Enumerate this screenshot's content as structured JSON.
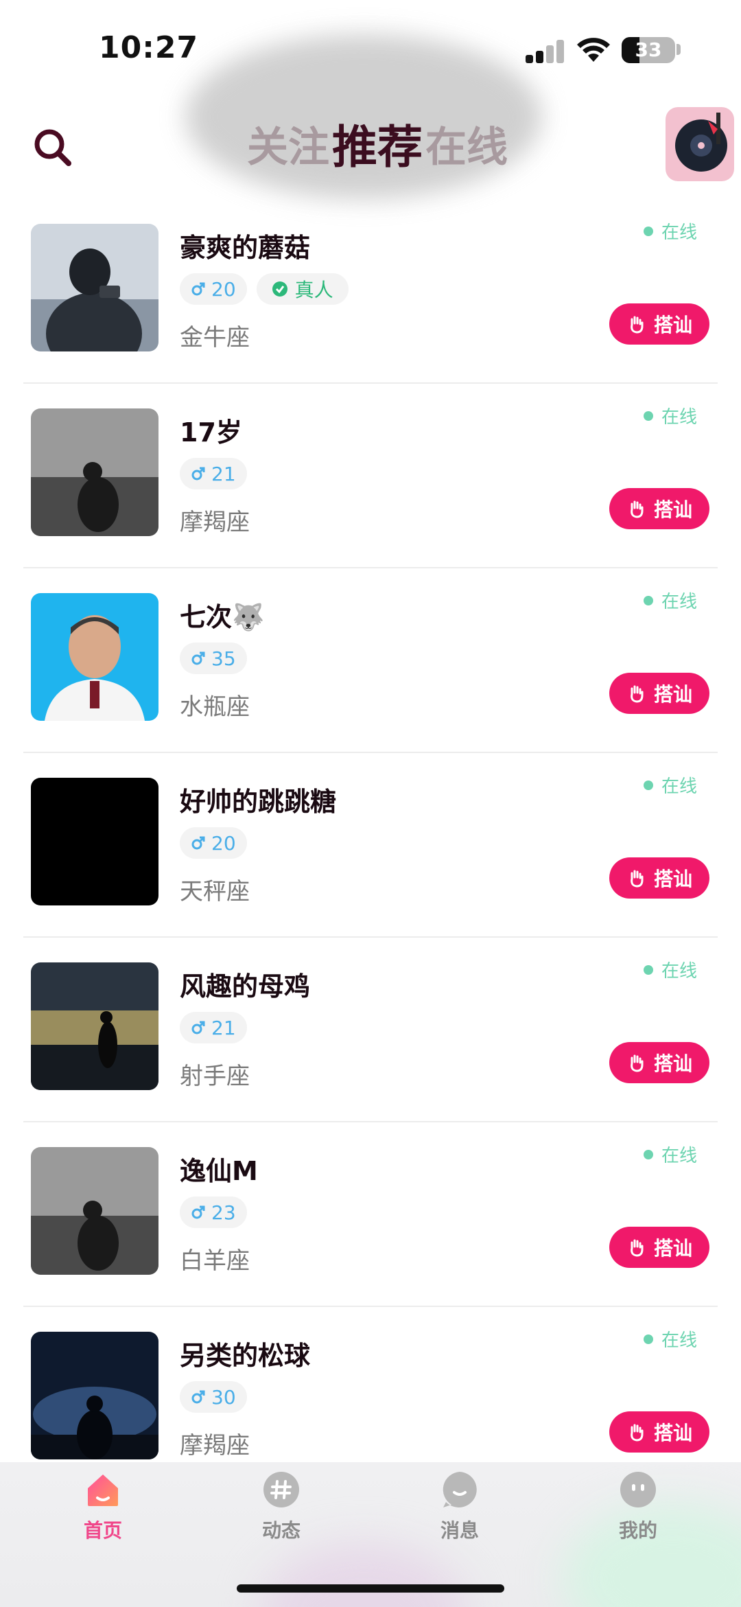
{
  "status": {
    "time": "10:27",
    "battery": "33"
  },
  "header": {
    "tabs": [
      {
        "label": "关注",
        "active": false
      },
      {
        "label": "推荐",
        "active": true
      },
      {
        "label": "在线",
        "active": false
      }
    ],
    "accent_gradient": [
      "#ef3d8a",
      "#ff8a3d"
    ]
  },
  "users": [
    {
      "name": "豪爽的蘑菇",
      "age": "20",
      "verified_label": "真人",
      "zodiac": "金牛座",
      "status": "在线",
      "action": "搭讪"
    },
    {
      "name": "17岁",
      "age": "21",
      "zodiac": "摩羯座",
      "status": "在线",
      "action": "搭讪"
    },
    {
      "name": "七次🐺",
      "age": "35",
      "zodiac": "水瓶座",
      "status": "在线",
      "action": "搭讪"
    },
    {
      "name": "好帅的跳跳糖",
      "age": "20",
      "zodiac": "天秤座",
      "status": "在线",
      "action": "搭讪"
    },
    {
      "name": "风趣的母鸡",
      "age": "21",
      "zodiac": "射手座",
      "status": "在线",
      "action": "搭讪"
    },
    {
      "name": "逸仙M",
      "age": "23",
      "zodiac": "白羊座",
      "status": "在线",
      "action": "搭讪"
    },
    {
      "name": "另类的松球",
      "age": "30",
      "zodiac": "摩羯座",
      "status": "在线",
      "action": "搭讪"
    }
  ],
  "nav": [
    {
      "label": "首页",
      "icon": "home-icon",
      "active": true
    },
    {
      "label": "动态",
      "icon": "hashtag-icon",
      "active": false
    },
    {
      "label": "消息",
      "icon": "message-icon",
      "active": false
    },
    {
      "label": "我的",
      "icon": "profile-icon",
      "active": false
    }
  ],
  "colors": {
    "accent": "#f0196a",
    "online": "#6dd4b0",
    "age": "#4aaee8",
    "verified": "#2cb87a"
  }
}
